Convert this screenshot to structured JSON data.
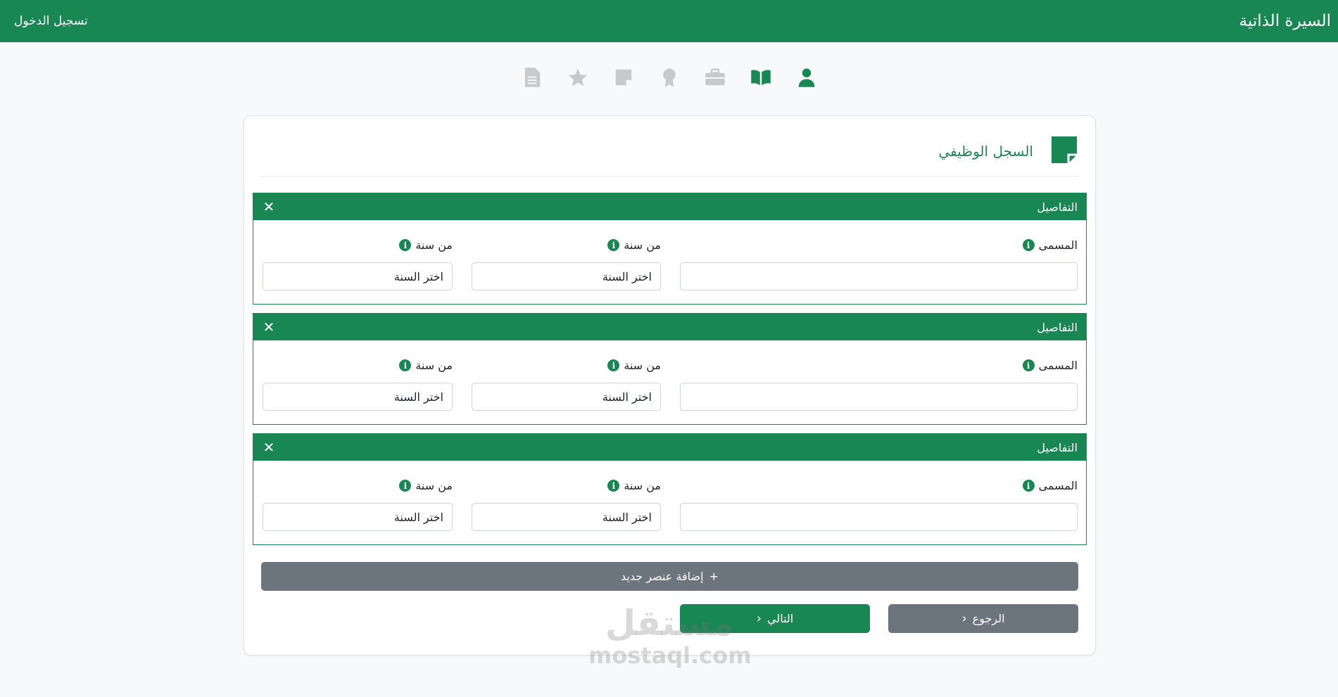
{
  "header": {
    "brand": "السيرة الذاتية",
    "login": "تسجيل الدخول"
  },
  "steps": [
    {
      "name": "profile-icon",
      "active": true
    },
    {
      "name": "book-icon",
      "active": true
    },
    {
      "name": "briefcase-icon",
      "active": false
    },
    {
      "name": "award-icon",
      "active": false
    },
    {
      "name": "sticky-note-icon",
      "active": false
    },
    {
      "name": "star-icon",
      "active": false
    },
    {
      "name": "document-icon",
      "active": false
    }
  ],
  "section": {
    "title": "السجل الوظيفي",
    "icon": "sticky-note-icon"
  },
  "entries": [
    {
      "head": "التفاصيل",
      "close": "✕",
      "title_label": "المسمى",
      "from_label_1": "من سنة",
      "from_label_2": "من سنة",
      "title_value": "",
      "from_value_1": "اختر السنة",
      "from_value_2": "اختر السنة"
    },
    {
      "head": "التفاصيل",
      "close": "✕",
      "title_label": "المسمى",
      "from_label_1": "من سنة",
      "from_label_2": "من سنة",
      "title_value": "",
      "from_value_1": "اختر السنة",
      "from_value_2": "اختر السنة"
    },
    {
      "head": "التفاصيل",
      "close": "✕",
      "title_label": "المسمى",
      "from_label_1": "من سنة",
      "from_label_2": "من سنة",
      "title_value": "",
      "from_value_1": "اختر السنة",
      "from_value_2": "اختر السنة"
    }
  ],
  "buttons": {
    "add_icon": "+",
    "add_label": "إضافة عنصر جديد",
    "next_label": "التالي",
    "back_label": "الرجوع",
    "chevron": "‹"
  },
  "watermark": {
    "arabic": "مستقل",
    "latin": "mostaql.com"
  },
  "colors": {
    "primary": "#198754",
    "secondary": "#6c757d",
    "inactive_icon": "#c7cacd"
  }
}
